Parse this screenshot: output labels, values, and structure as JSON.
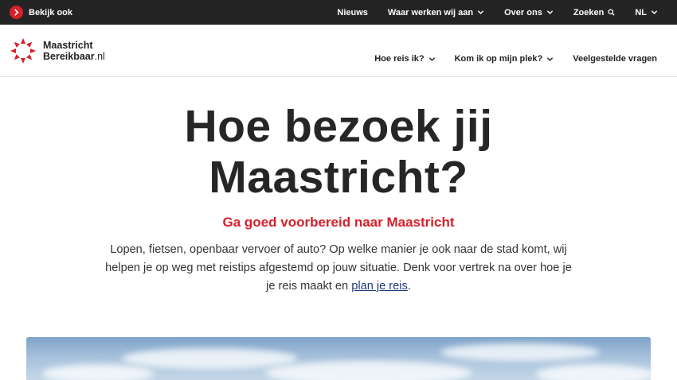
{
  "topbar": {
    "see_also_label": "Bekijk ook",
    "nav": [
      {
        "label": "Nieuws",
        "has_dropdown": false
      },
      {
        "label": "Waar werken wij aan",
        "has_dropdown": true
      },
      {
        "label": "Over ons",
        "has_dropdown": true
      },
      {
        "label": "Zoeken",
        "has_dropdown": false
      },
      {
        "label": "NL",
        "has_dropdown": true
      }
    ]
  },
  "logo": {
    "line1": "Maastricht",
    "line2": "Bereikbaar",
    "suffix": ".nl"
  },
  "main_nav": [
    {
      "label": "Hoe reis ik?",
      "has_dropdown": true
    },
    {
      "label": "Kom ik op mijn plek?",
      "has_dropdown": true
    },
    {
      "label": "Veelgestelde vragen",
      "has_dropdown": false
    }
  ],
  "hero": {
    "title_line1": "Hoe bezoek jij",
    "title_line2": "Maastricht?",
    "subtitle": "Ga goed voorbereid naar Maastricht",
    "intro_text": "Lopen, fietsen, openbaar vervoer of auto? Op welke manier je ook naar de stad komt, wij helpen je op weg met reistips afgestemd op jouw situatie. Denk voor vertrek na over hoe je je reis maakt en",
    "intro_link": "plan je reis",
    "intro_end": "."
  },
  "colors": {
    "brand_red": "#d6202a",
    "topbar_bg": "#242424",
    "link_blue": "#1e3a7b"
  }
}
